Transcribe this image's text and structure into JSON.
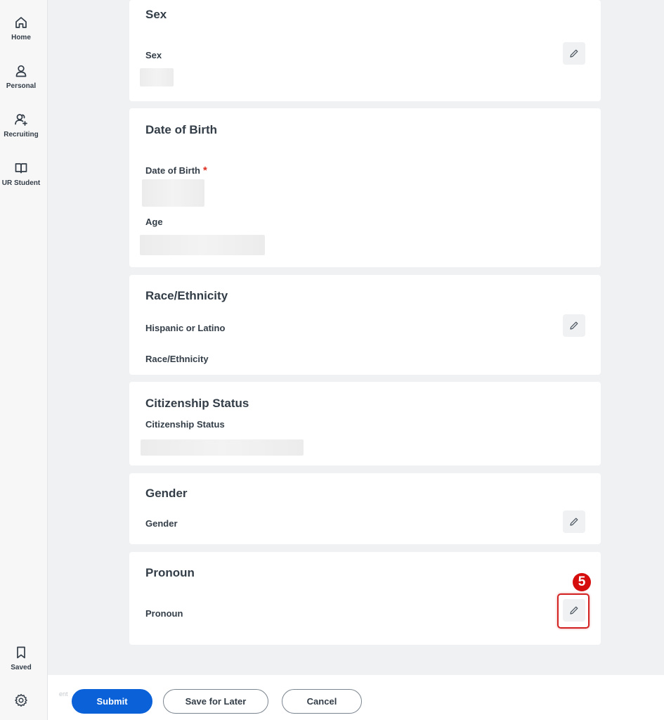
{
  "sidebar": {
    "items": [
      {
        "label": "Home",
        "icon": "home-icon"
      },
      {
        "label": "Personal",
        "icon": "person-icon"
      },
      {
        "label": "Recruiting",
        "icon": "recruiting-icon"
      },
      {
        "label": "UR Student",
        "icon": "book-icon"
      }
    ],
    "bottom": [
      {
        "label": "Saved",
        "icon": "bookmark-icon"
      },
      {
        "label": "",
        "icon": "gear-icon"
      }
    ]
  },
  "sections": {
    "sex": {
      "title": "Sex",
      "field": "Sex"
    },
    "dob": {
      "title": "Date of Birth",
      "field": "Date of Birth",
      "required_mark": "*",
      "age_label": "Age"
    },
    "race": {
      "title": "Race/Ethnicity",
      "field1": "Hispanic or Latino",
      "field2": "Race/Ethnicity"
    },
    "citizenship": {
      "title": "Citizenship Status",
      "field": "Citizenship Status"
    },
    "gender": {
      "title": "Gender",
      "field": "Gender"
    },
    "pronoun": {
      "title": "Pronoun",
      "field": "Pronoun"
    }
  },
  "annotation": {
    "step": "5",
    "color": "#d60d0d"
  },
  "footer": {
    "faint_text": "ent",
    "submit": "Submit",
    "save_for_later": "Save for Later",
    "cancel": "Cancel"
  },
  "colors": {
    "primary": "#0b61d8",
    "background": "#f0f1f2",
    "required": "#de2e21"
  }
}
